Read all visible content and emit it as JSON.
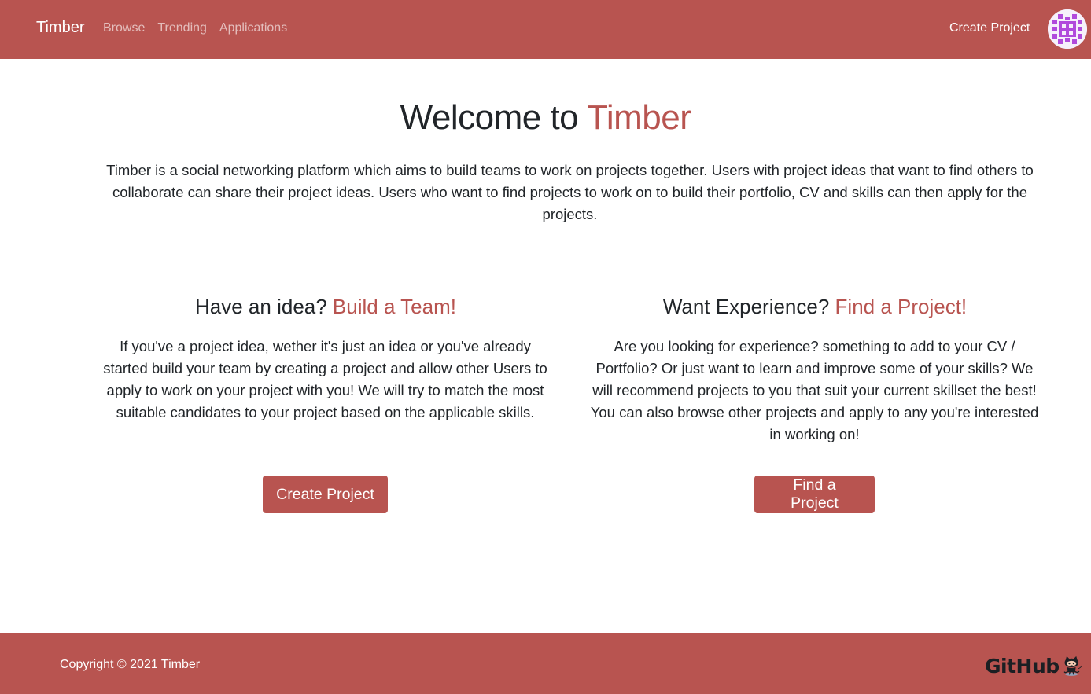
{
  "navbar": {
    "brand": "Timber",
    "links": [
      "Browse",
      "Trending",
      "Applications"
    ],
    "create_label": "Create Project",
    "avatar_icon": "identicon-avatar-icon"
  },
  "hero": {
    "title_prefix": "Welcome to ",
    "title_accent": "Timber",
    "intro": "Timber is a social networking platform which aims to build teams to work on projects together. Users with project ideas that want to find others to collaborate can share their project ideas. Users who want to find projects to work on to build their portfolio, CV and skills can then apply for the projects."
  },
  "left_col": {
    "title_prefix": "Have an idea? ",
    "title_accent": "Build a Team!",
    "text": "If you've a project idea, wether it's just an idea or you've already started build your team by creating a project and allow other Users to apply to work on your project with you! We will try to match the most suitable candidates to your project based on the applicable skills.",
    "button": "Create Project"
  },
  "right_col": {
    "title_prefix": "Want Experience? ",
    "title_accent": "Find a Project!",
    "text": "Are you looking for experience? something to add to your CV / Portfolio? Or just want to learn and improve some of your skills? We will recommend projects to you that suit your current skillset the best! You can also browse other projects and apply to any you're interested in working on!",
    "button": "Find a Project"
  },
  "footer": {
    "copyright": "Copyright © 2021 Timber",
    "github_label": "GitHub",
    "github_icon": "octocat-icon"
  },
  "colors": {
    "accent": "#b85450",
    "text": "#212529",
    "nav_link_muted": "rgba(255,255,255,0.62)",
    "avatar_purple": "#b14bdc"
  }
}
